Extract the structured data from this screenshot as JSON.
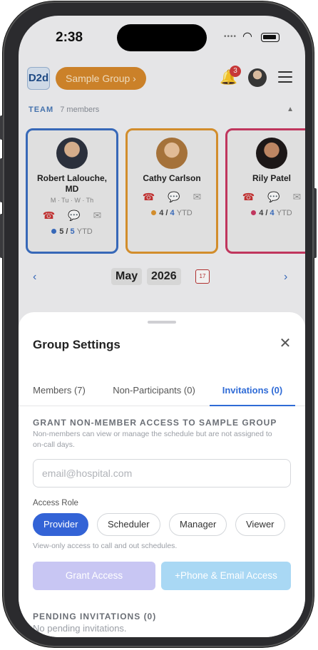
{
  "status_bar": {
    "time": "2:38"
  },
  "header": {
    "logo_text": "D2d",
    "group_label": "Sample Group ›",
    "notification_count": "3"
  },
  "team": {
    "label": "TEAM",
    "count": "7 members",
    "members": [
      {
        "name": "Robert Lalouche, MD",
        "days": "M · Tu · W · Th",
        "ytd_done": "5",
        "ytd_total": "5",
        "ytd_suffix": "YTD",
        "color": "#3b6fc4"
      },
      {
        "name": "Cathy Carlson",
        "days": "",
        "ytd_done": "4",
        "ytd_total": "4",
        "ytd_suffix": "YTD",
        "color": "#e0962f"
      },
      {
        "name": "Rily Patel",
        "days": "",
        "ytd_done": "4",
        "ytd_total": "4",
        "ytd_suffix": "YTD",
        "color": "#cc3a64"
      }
    ]
  },
  "calendar_nav": {
    "month": "May",
    "year": "2026",
    "calendar_day": "17",
    "prev_icon": "‹",
    "next_icon": "›"
  },
  "sheet": {
    "title": "Group Settings",
    "tabs": [
      {
        "label": "Members (7)",
        "active": false
      },
      {
        "label": "Non-Participants (0)",
        "active": false
      },
      {
        "label": "Invitations (0)",
        "active": true
      }
    ],
    "grant_title": "GRANT NON-MEMBER ACCESS TO SAMPLE GROUP",
    "grant_desc": "Non-members can view or manage the schedule but are not assigned to on-call days.",
    "email_placeholder": "email@hospital.com",
    "access_role_label": "Access Role",
    "roles": [
      {
        "label": "Provider",
        "active": true
      },
      {
        "label": "Scheduler",
        "active": false
      },
      {
        "label": "Manager",
        "active": false
      },
      {
        "label": "Viewer",
        "active": false
      }
    ],
    "role_hint": "View-only access to call and out schedules.",
    "grant_button": "Grant Access",
    "phone_email_button": "+Phone & Email Access",
    "pending_title": "PENDING INVITATIONS (0)",
    "pending_empty": "No pending invitations."
  },
  "colors": {
    "accent": "#2f6bd6",
    "group_pill": "#d88a2c",
    "provider_active": "#3363d6"
  }
}
